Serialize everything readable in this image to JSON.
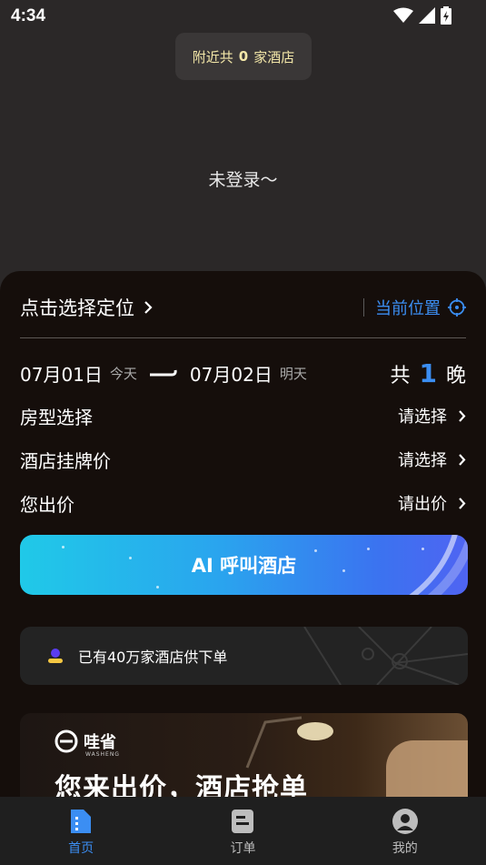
{
  "status": {
    "time": "4:34"
  },
  "toast": {
    "prefix": "附近共",
    "count": "0",
    "suffix": "家酒店"
  },
  "login_text": "未登录～",
  "location": {
    "label": "点击选择定位",
    "current": "当前位置"
  },
  "dates": {
    "checkin": "07月01日",
    "checkin_tag": "今天",
    "checkout": "07月02日",
    "checkout_tag": "明天",
    "nights_prefix": "共",
    "nights": "1",
    "nights_suffix": "晚"
  },
  "rows": [
    {
      "label": "房型选择",
      "value": "请选择"
    },
    {
      "label": "酒店挂牌价",
      "value": "请选择"
    },
    {
      "label": "您出价",
      "value": "请出价"
    }
  ],
  "ai_button": {
    "label": "AI 呼叫酒店"
  },
  "info_card": {
    "text": "已有40万家酒店供下单"
  },
  "banner": {
    "brand": "哇省",
    "brand_sub": "WASHENG",
    "title": "您来出价，酒店抢单"
  },
  "nav": [
    {
      "label": "首页",
      "icon": "home-icon",
      "active": true
    },
    {
      "label": "订单",
      "icon": "order-icon",
      "active": false
    },
    {
      "label": "我的",
      "icon": "profile-icon",
      "active": false
    }
  ],
  "colors": {
    "accent": "#3b8ef3",
    "panel": "#150e0b",
    "background": "#2b2828"
  }
}
